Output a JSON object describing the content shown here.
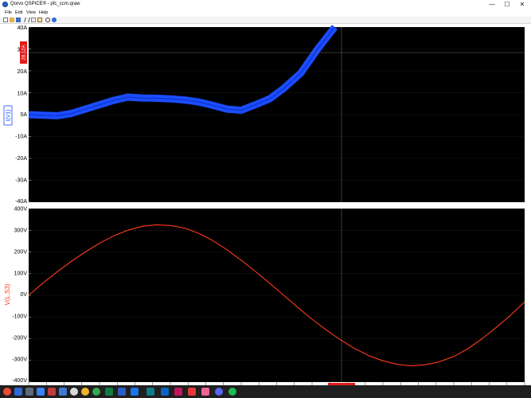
{
  "window": {
    "title": "Qorvo QSPICE® - pfc_ccm.qraw",
    "minimize_glyph": "—",
    "maximize_glyph": "☐",
    "close_glyph": "✕"
  },
  "menu": [
    "File",
    "Edit",
    "View",
    "Help"
  ],
  "toolbar": {
    "icons": [
      "new-file-icon",
      "open-file-icon",
      "save-icon",
      "cut-icon",
      "copy-icon",
      "paste-icon",
      "zoom-icon",
      "help-icon"
    ]
  },
  "plots": {
    "top": {
      "trace_label": "I(V1)",
      "trace_color": "#1a4dff",
      "y_ticks": [
        "40A",
        "30A",
        "20A",
        "10A",
        "0A",
        "-10A",
        "-20A",
        "-30A",
        "-40A"
      ],
      "cursor_readout": "28.12A"
    },
    "bottom": {
      "trace_label": "V(L,S3)",
      "trace_color": "#ff3b1a",
      "y_ticks": [
        "400V",
        "300V",
        "200V",
        "100V",
        "0V",
        "-100V",
        "-200V",
        "-300V",
        "-400V"
      ]
    }
  },
  "chart_data": [
    {
      "type": "line",
      "title": "",
      "ylabel": "I(V1)",
      "ylim": [
        -40,
        40
      ],
      "series": [
        {
          "name": "I(V1)",
          "x": [
            0,
            0.5,
            1,
            1.5,
            2,
            2.5,
            3,
            3.5,
            4,
            4.5,
            5,
            5.5,
            6,
            6.5,
            7,
            7.5,
            8,
            8.5,
            9,
            9.6,
            10.2,
            10.8
          ],
          "values": [
            0,
            -0.3,
            -0.5,
            0.5,
            2.5,
            4.5,
            6.5,
            8,
            7.6,
            7.5,
            7.2,
            6.7,
            5.8,
            4.2,
            2.5,
            2,
            4.5,
            7.2,
            12,
            19,
            30,
            40
          ]
        }
      ]
    },
    {
      "type": "line",
      "title": "",
      "ylabel": "V(L,S3)",
      "ylim": [
        -400,
        400
      ],
      "series": [
        {
          "name": "V(L,S3)",
          "x": [
            0,
            0.5,
            1,
            1.5,
            2,
            2.5,
            3,
            3.5,
            4,
            4.5,
            5,
            5.5,
            6,
            6.5,
            7,
            7.5,
            8,
            8.5,
            9,
            9.5,
            10,
            10.5,
            11,
            11.5,
            12,
            12.5,
            13,
            13.5,
            14,
            14.5,
            15,
            15.5,
            16,
            16.5,
            17,
            17.5
          ],
          "values": [
            0,
            56,
            108,
            156,
            200,
            240,
            274,
            300,
            318,
            325,
            322,
            310,
            286,
            252,
            210,
            162,
            110,
            56,
            0,
            -56,
            -110,
            -160,
            -205,
            -245,
            -278,
            -302,
            -318,
            -325,
            -320,
            -306,
            -282,
            -246,
            -200,
            -148,
            -92,
            -30
          ]
        }
      ]
    }
  ]
}
